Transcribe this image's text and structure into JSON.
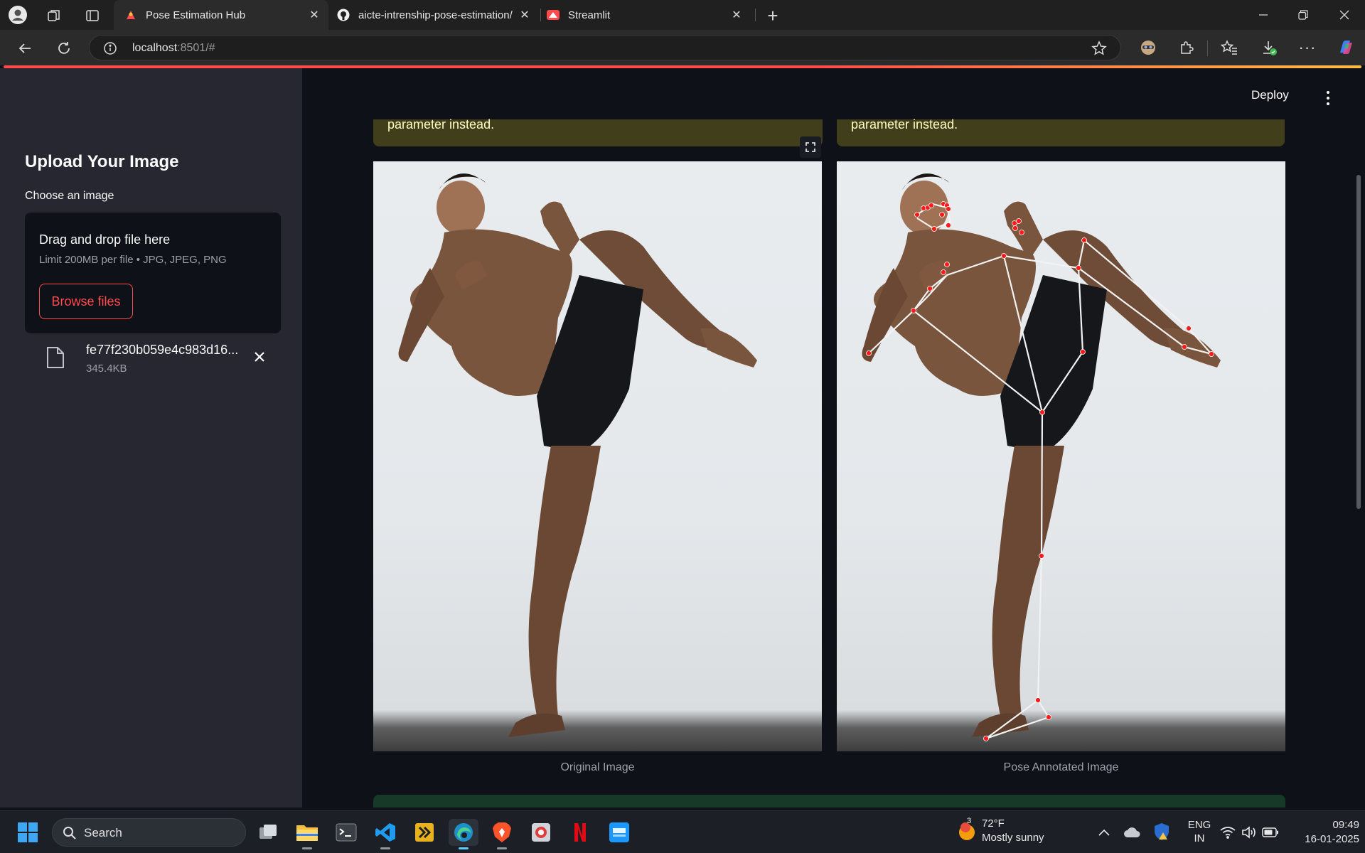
{
  "browser": {
    "tabs": [
      {
        "title": "Pose Estimation Hub",
        "active": true
      },
      {
        "title": "aicte-intrenship-pose-estimation/",
        "active": false
      },
      {
        "title": "Streamlit",
        "active": false
      }
    ],
    "url_host": "localhost",
    "url_rest": ":8501/#"
  },
  "sidebar": {
    "title": "Upload Your Image",
    "uploader_label": "Choose an image",
    "dropzone_title": "Drag and drop file here",
    "dropzone_limit": "Limit 200MB per file • JPG, JPEG, PNG",
    "browse_label": "Browse files",
    "file": {
      "name": "fe77f230b059e4c983d16...",
      "size": "345.4KB"
    }
  },
  "header": {
    "deploy_label": "Deploy"
  },
  "main": {
    "warning_text": "parameter instead.",
    "original_caption": "Original Image",
    "annotated_caption": "Pose Annotated Image"
  },
  "taskbar": {
    "search_label": "Search",
    "weather_temp": "72°F",
    "weather_desc": "Mostly sunny",
    "weather_badge": "3",
    "lang_top": "ENG",
    "lang_bottom": "IN",
    "time": "09:49",
    "date": "16-01-2025"
  },
  "colors": {
    "accent": "#ff4b4b",
    "sidebar_bg": "#262730",
    "main_bg": "#0e1117",
    "warning_bg": "#413e1c",
    "warning_text": "#ffffc2",
    "keypoint": "#ff1a1a",
    "skeleton": "#ffffff"
  },
  "icons": [
    "profile-icon",
    "workspaces-icon",
    "tab-actions-icon",
    "plus-icon",
    "minimize-icon",
    "restore-icon",
    "close-icon",
    "back-icon",
    "reload-icon",
    "info-icon",
    "star-icon",
    "extension-icon",
    "favorites-icon",
    "download-icon",
    "more-icon",
    "copilot-icon",
    "file-icon",
    "fullscreen-icon",
    "windows-start-icon",
    "search-icon",
    "wifi-icon",
    "volume-icon",
    "battery-icon"
  ]
}
